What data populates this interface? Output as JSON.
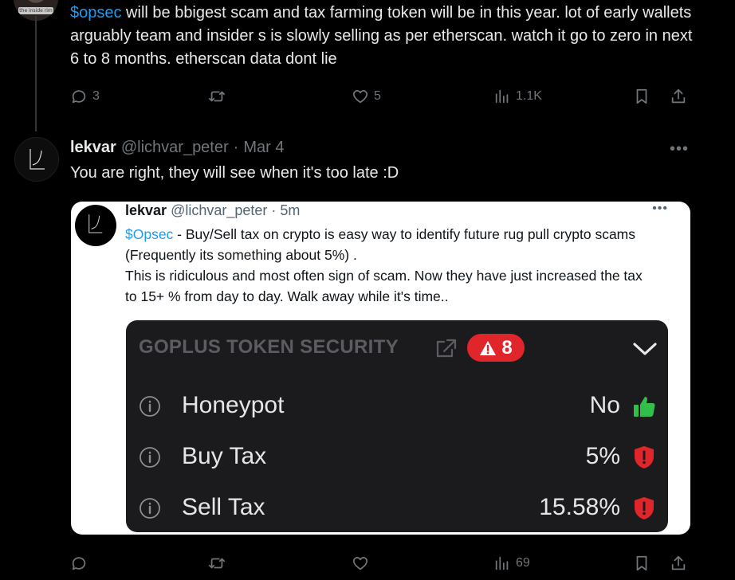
{
  "top_tweet": {
    "avatar_caption": "the inside rim",
    "cashtag": "$opsec",
    "text": " will be bbigest scam and tax farming token will be in this year. lot of early wallets arguably team and insider s is slowly selling as per etherscan. watch it go to zero in next 6 to 8 months. etherscan data dont lie",
    "actions": {
      "replies": "3",
      "retweets": "",
      "likes": "5",
      "views": "1.1K"
    }
  },
  "reply_tweet": {
    "display_name": "lekvar",
    "handle": "@lichvar_peter",
    "separator": "·",
    "date": "Mar 4",
    "text": "You are right, they will see when it's too late :D",
    "actions": {
      "replies": "",
      "retweets": "",
      "likes": "",
      "views": "69"
    }
  },
  "quoted_tweet": {
    "display_name": "lekvar",
    "handle": "@lichvar_peter",
    "separator": "·",
    "time": "5m",
    "cashtag": "$Opsec",
    "text": " - Buy/Sell tax on crypto is easy way to identify future rug pull crypto scams (Frequently its something about 5%) .\nThis is ridiculous and most often sign of scam. Now they have just increased the tax to 15+ % from day to day. Walk away while it's time.."
  },
  "goplus": {
    "title": "GOPLUS TOKEN SECURITY",
    "warnings_count": "8",
    "rows": [
      {
        "label": "Honeypot",
        "value": "No",
        "status_icon": "thumbs-up-icon"
      },
      {
        "label": "Buy Tax",
        "value": "5%",
        "status_icon": "shield-alert-icon"
      },
      {
        "label": "Sell Tax",
        "value": "15.58%",
        "status_icon": "shield-alert-icon"
      }
    ]
  },
  "colors": {
    "accent": "#1d9bf0",
    "muted": "#71767b",
    "alert": "#e0262b",
    "safe": "#2fbf4a"
  }
}
